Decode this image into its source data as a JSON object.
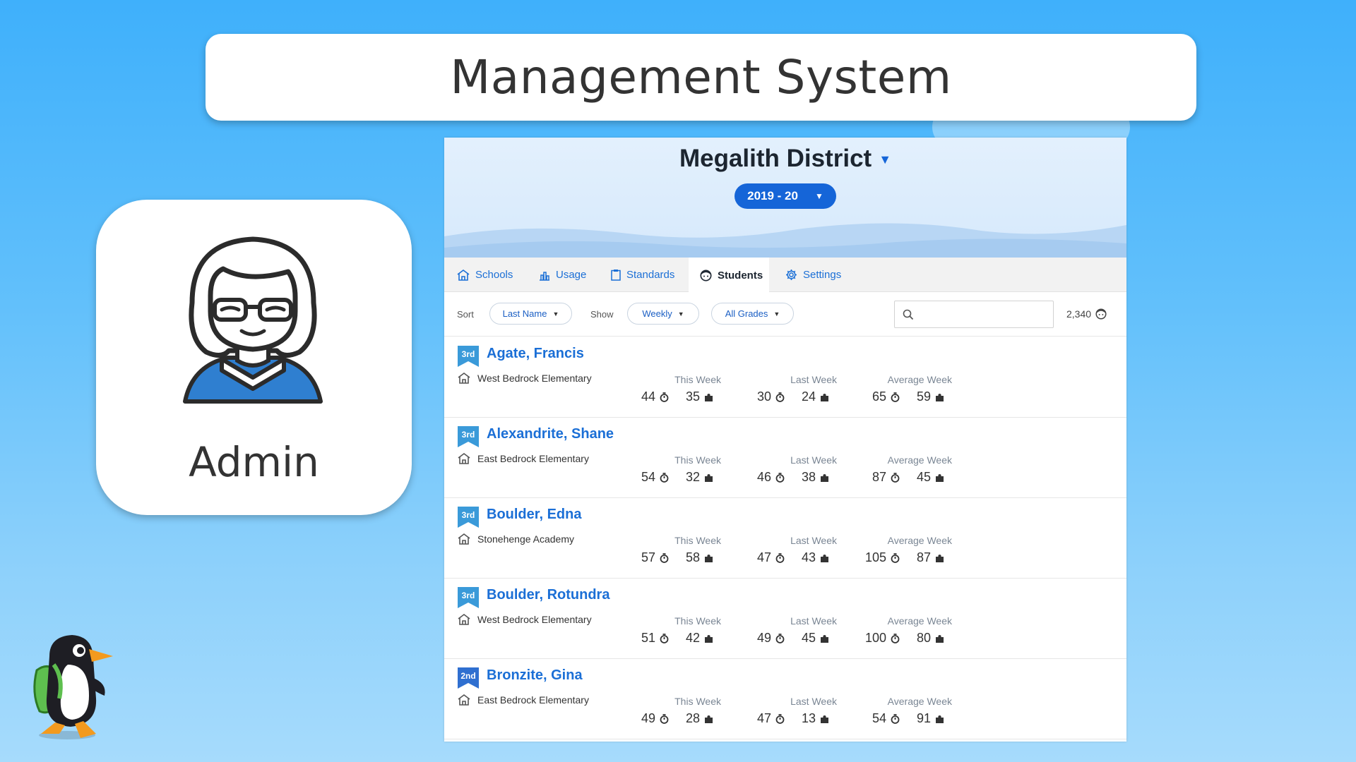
{
  "slide": {
    "title": "Management System",
    "admin_label": "Admin"
  },
  "app": {
    "district": "Megalith District",
    "year": "2019 - 20",
    "tabs": [
      {
        "label": "Schools",
        "icon": "school-icon"
      },
      {
        "label": "Usage",
        "icon": "bar-chart-icon"
      },
      {
        "label": "Standards",
        "icon": "clipboard-icon"
      },
      {
        "label": "Students",
        "icon": "student-face-icon",
        "active": true
      },
      {
        "label": "Settings",
        "icon": "gear-icon"
      }
    ],
    "toolbar": {
      "sort_label": "Sort",
      "sort_value": "Last Name",
      "show_label": "Show",
      "show_value": "Weekly",
      "grade_value": "All Grades",
      "search_placeholder": "",
      "count": "2,340"
    },
    "week_labels": {
      "this_week": "This Week",
      "last_week": "Last Week",
      "average_week": "Average Week"
    },
    "students": [
      {
        "grade": "3rd",
        "name": "Agate, Francis",
        "school": "West Bedrock Elementary",
        "this_week": {
          "time": "44",
          "puzzles": "35"
        },
        "last_week": {
          "time": "30",
          "puzzles": "24"
        },
        "average_week": {
          "time": "65",
          "puzzles": "59"
        }
      },
      {
        "grade": "3rd",
        "name": "Alexandrite, Shane",
        "school": "East Bedrock Elementary",
        "this_week": {
          "time": "54",
          "puzzles": "32"
        },
        "last_week": {
          "time": "46",
          "puzzles": "38"
        },
        "average_week": {
          "time": "87",
          "puzzles": "45"
        }
      },
      {
        "grade": "3rd",
        "name": "Boulder, Edna",
        "school": "Stonehenge Academy",
        "this_week": {
          "time": "57",
          "puzzles": "58"
        },
        "last_week": {
          "time": "47",
          "puzzles": "43"
        },
        "average_week": {
          "time": "105",
          "puzzles": "87"
        }
      },
      {
        "grade": "3rd",
        "name": "Boulder, Rotundra",
        "school": "West Bedrock Elementary",
        "this_week": {
          "time": "51",
          "puzzles": "42"
        },
        "last_week": {
          "time": "49",
          "puzzles": "45"
        },
        "average_week": {
          "time": "100",
          "puzzles": "80"
        }
      },
      {
        "grade": "2nd",
        "name": "Bronzite, Gina",
        "school": "East Bedrock Elementary",
        "this_week": {
          "time": "49",
          "puzzles": "28"
        },
        "last_week": {
          "time": "47",
          "puzzles": "13"
        },
        "average_week": {
          "time": "54",
          "puzzles": "91"
        }
      }
    ]
  },
  "colors": {
    "accent": "#1565d8",
    "link": "#1b6fd6",
    "grade_3rd": "#3a9ad9",
    "grade_2nd": "#2f6fd0"
  }
}
